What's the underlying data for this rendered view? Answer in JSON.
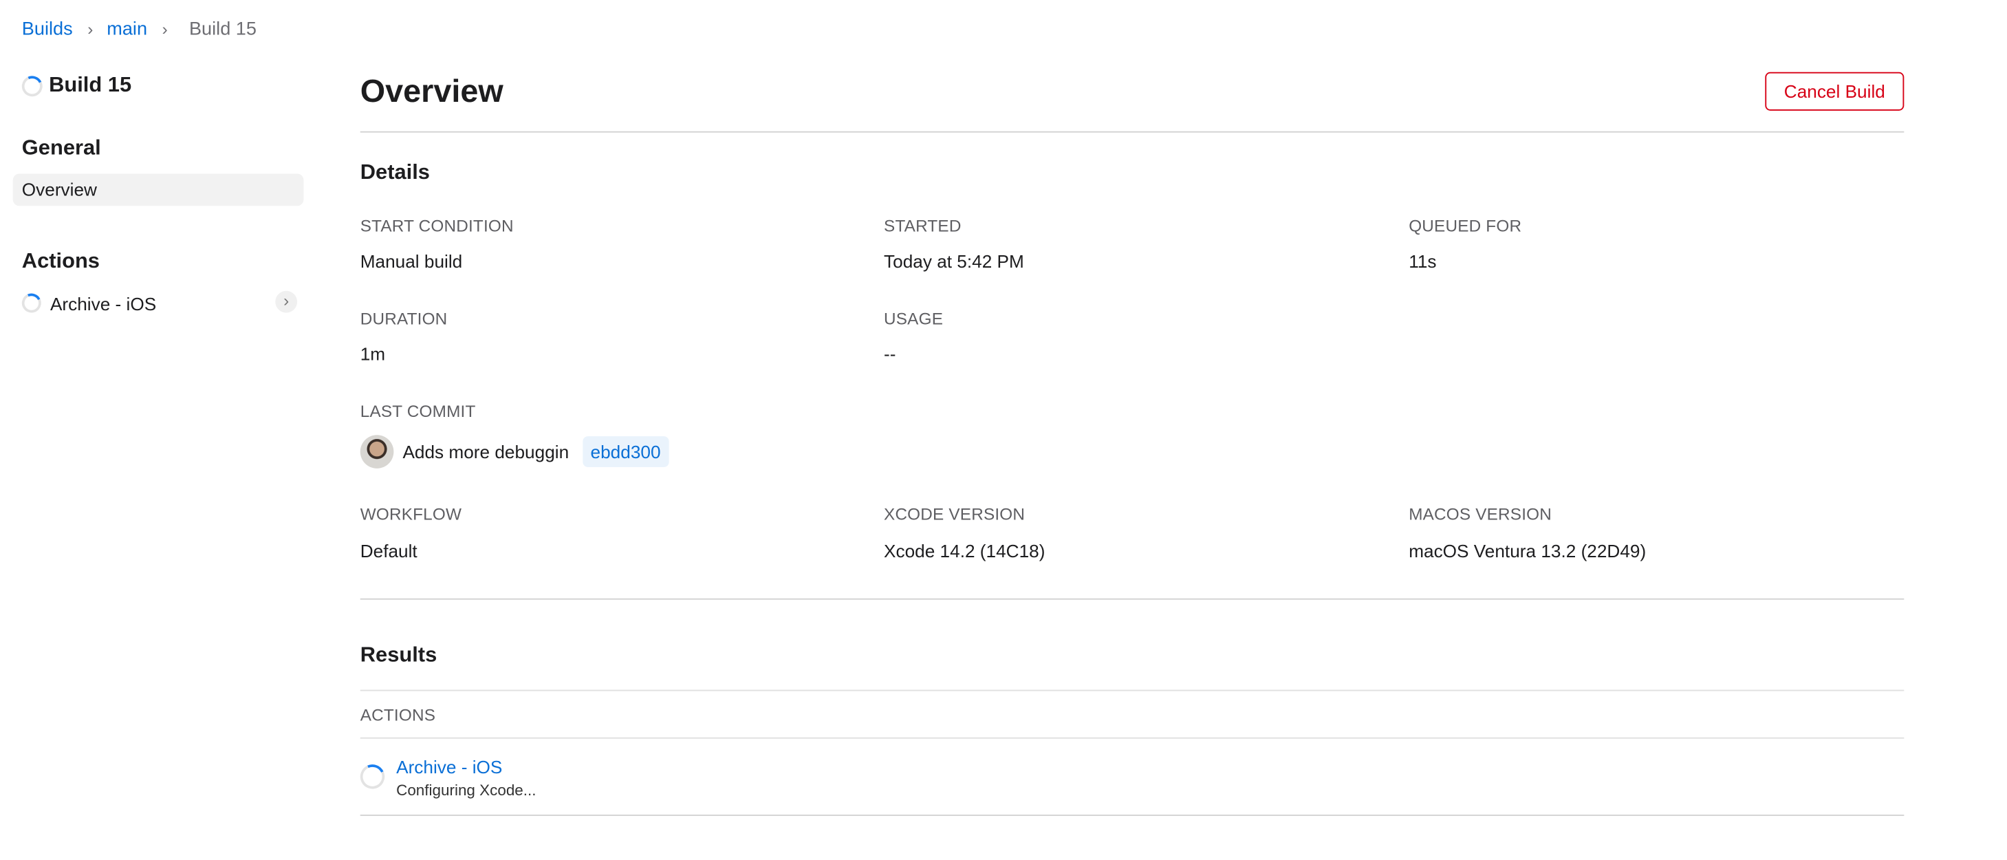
{
  "breadcrumb": {
    "items": [
      "Builds",
      "main",
      "Build 15"
    ],
    "separator": ">"
  },
  "sidebar": {
    "build_title": "Build 15",
    "general_heading": "General",
    "general_items": [
      {
        "label": "Overview",
        "selected": true
      }
    ],
    "actions_heading": "Actions",
    "action_items": [
      {
        "label": "Archive - iOS",
        "status": "in-progress"
      }
    ]
  },
  "main": {
    "title": "Overview",
    "cancel_label": "Cancel Build",
    "details": {
      "heading": "Details",
      "start_condition": {
        "label": "Start Condition",
        "value": "Manual build"
      },
      "started": {
        "label": "Started",
        "value": "Today at 5:42 PM"
      },
      "queued_for": {
        "label": "Queued For",
        "value": "11s"
      },
      "duration": {
        "label": "Duration",
        "value": "1m"
      },
      "usage": {
        "label": "Usage",
        "value": "--"
      },
      "last_commit": {
        "label": "Last Commit",
        "message": "Adds more debuggin",
        "hash": "ebdd300"
      },
      "workflow": {
        "label": "Workflow",
        "value": "Default"
      },
      "xcode_version": {
        "label": "Xcode Version",
        "value": "Xcode 14.2 (14C18)"
      },
      "macos_version": {
        "label": "macOS Version",
        "value": "macOS Ventura 13.2 (22D49)"
      }
    },
    "results": {
      "heading": "Results",
      "column": "Actions",
      "rows": [
        {
          "name": "Archive - iOS",
          "status": "Configuring Xcode..."
        }
      ]
    }
  },
  "colors": {
    "accent": "#0a6fd6",
    "danger": "#d70015",
    "selected_bg": "#f2f2f2",
    "hash_bg": "#eaf3fc"
  }
}
